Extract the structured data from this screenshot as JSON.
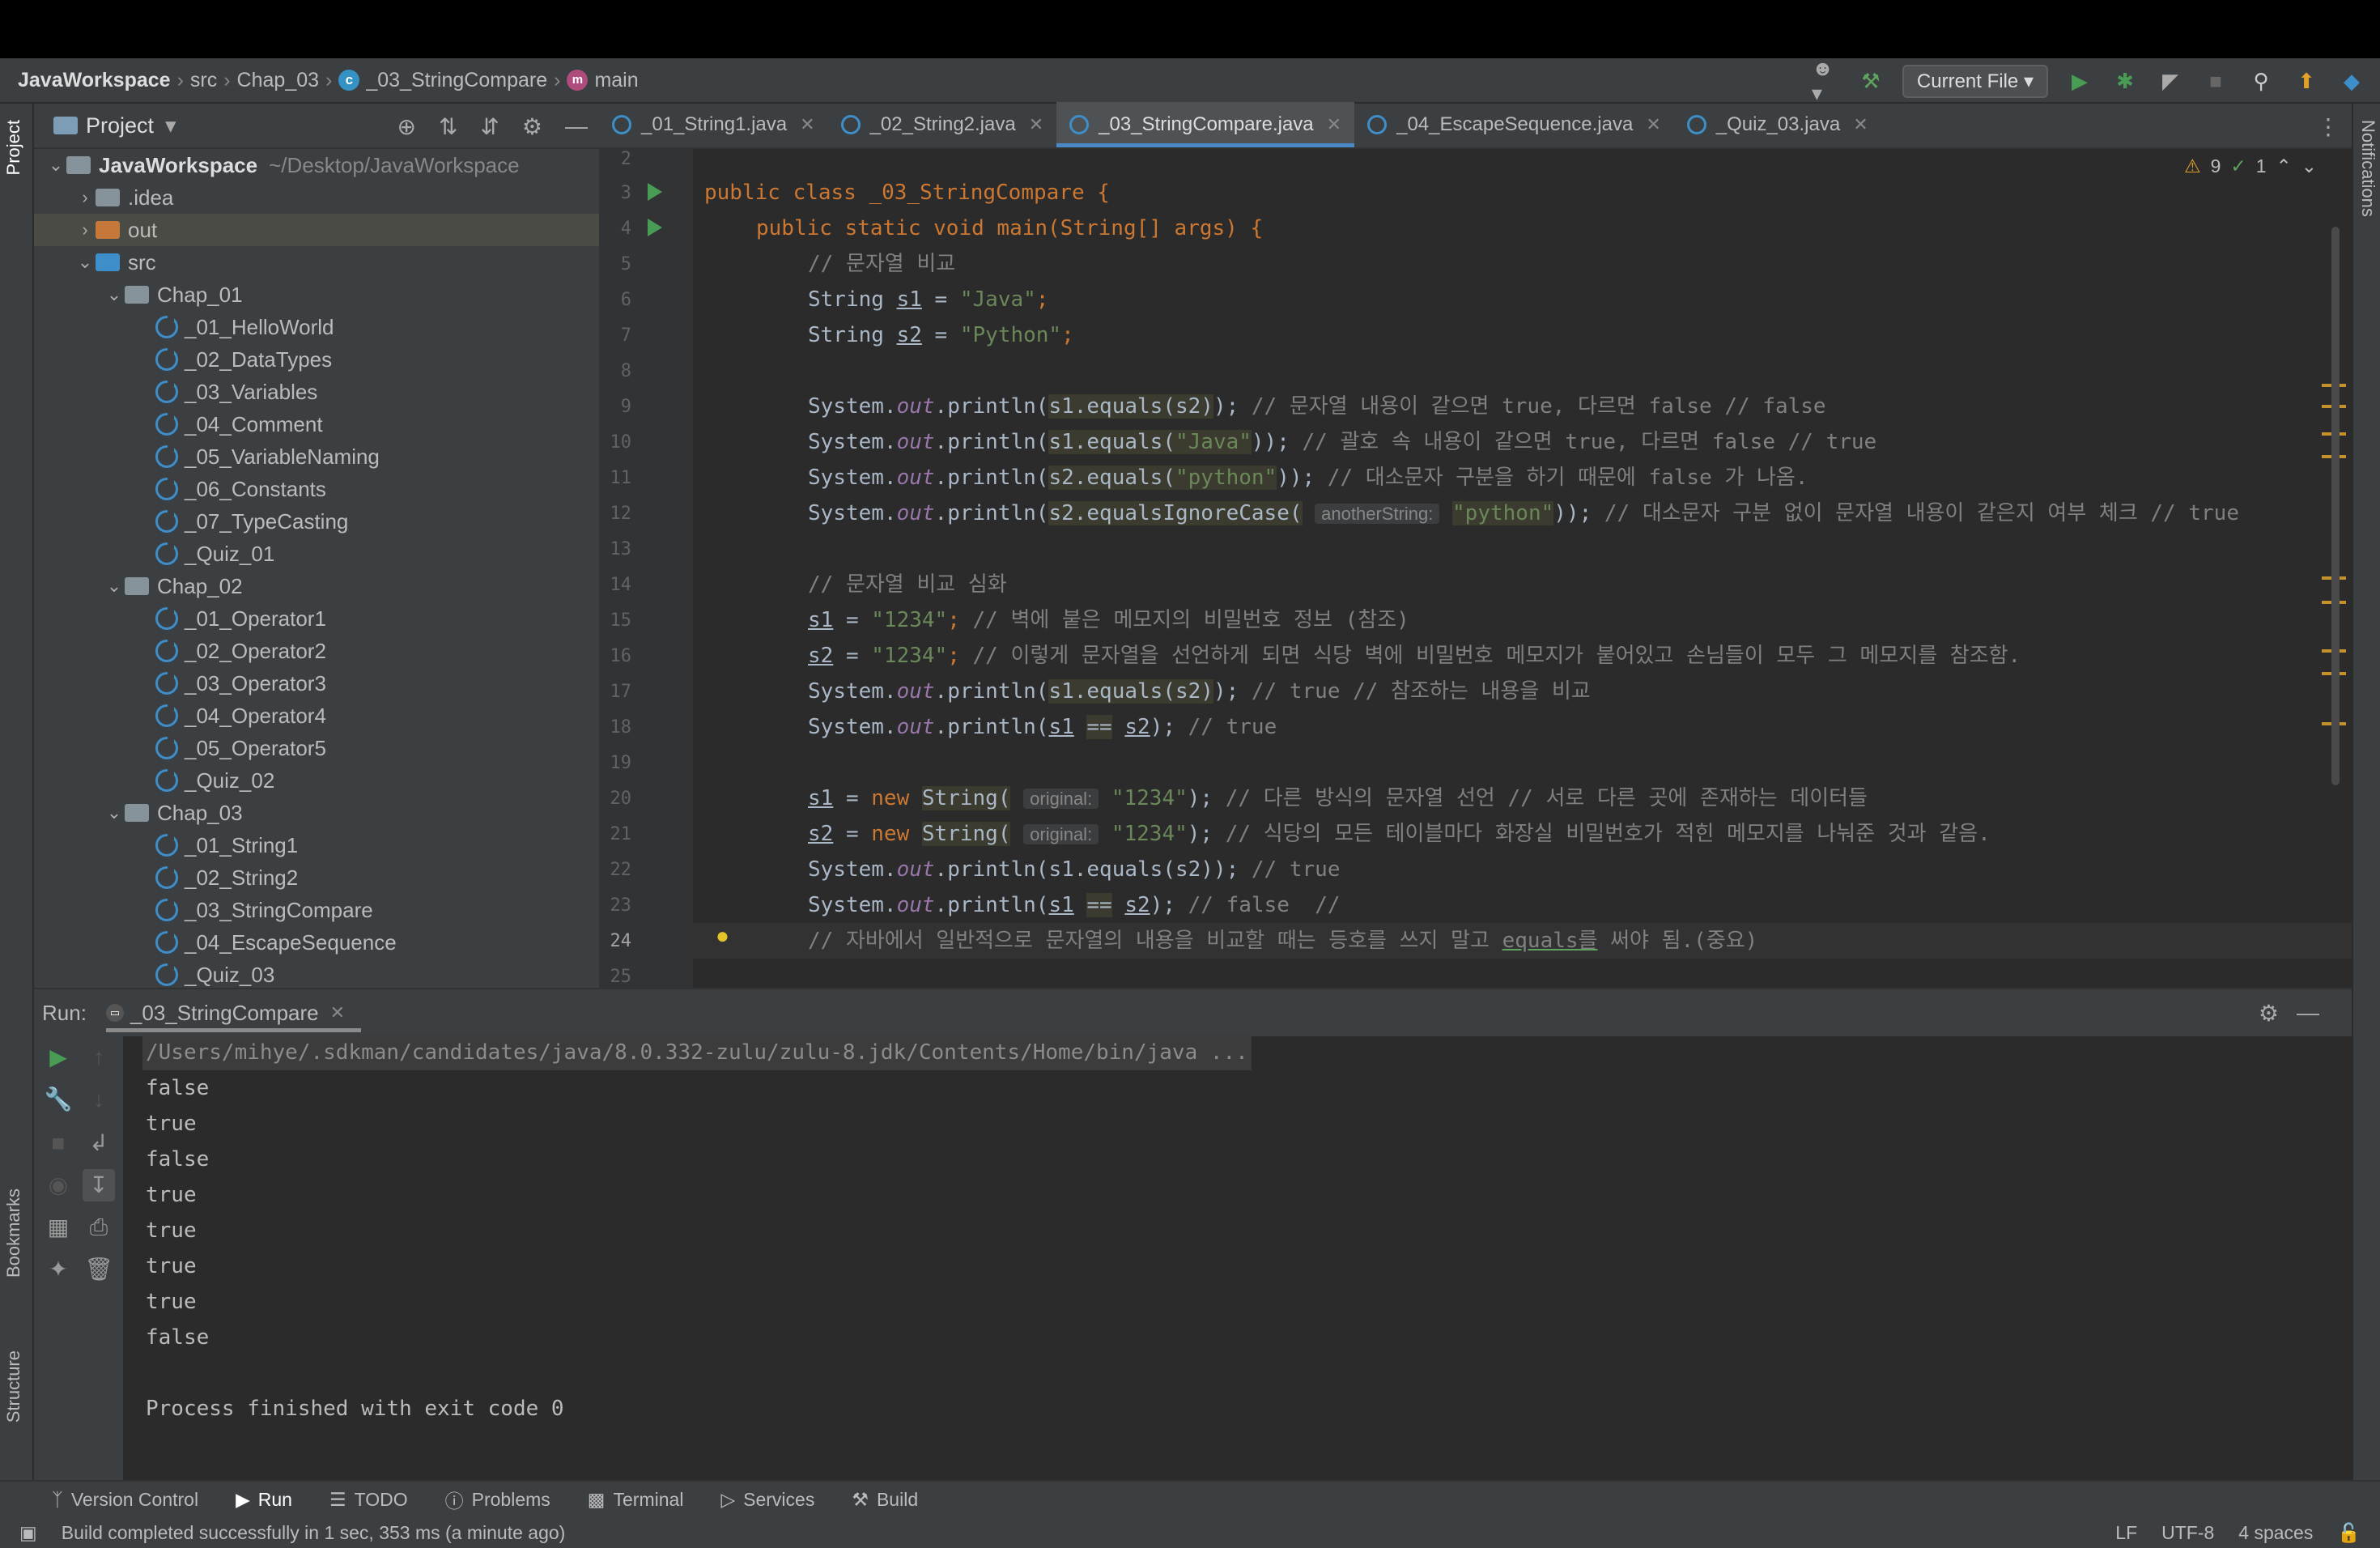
{
  "navbar": {
    "crumbs": [
      "JavaWorkspace",
      "src",
      "Chap_03",
      "_03_StringCompare",
      "main"
    ],
    "run_config": "Current File ▾"
  },
  "project": {
    "title": "Project",
    "root": {
      "name": "JavaWorkspace",
      "path": "~/Desktop/JavaWorkspace"
    },
    "items": [
      {
        "label": ".idea",
        "kind": "folder"
      },
      {
        "label": "out",
        "kind": "folder-orange"
      },
      {
        "label": "src",
        "kind": "folder-blue"
      },
      {
        "label": "Chap_01",
        "kind": "package"
      },
      {
        "label": "_01_HelloWorld",
        "kind": "class"
      },
      {
        "label": "_02_DataTypes",
        "kind": "class"
      },
      {
        "label": "_03_Variables",
        "kind": "class"
      },
      {
        "label": "_04_Comment",
        "kind": "class"
      },
      {
        "label": "_05_VariableNaming",
        "kind": "class"
      },
      {
        "label": "_06_Constants",
        "kind": "class"
      },
      {
        "label": "_07_TypeCasting",
        "kind": "class"
      },
      {
        "label": "_Quiz_01",
        "kind": "class"
      },
      {
        "label": "Chap_02",
        "kind": "package"
      },
      {
        "label": "_01_Operator1",
        "kind": "class"
      },
      {
        "label": "_02_Operator2",
        "kind": "class"
      },
      {
        "label": "_03_Operator3",
        "kind": "class"
      },
      {
        "label": "_04_Operator4",
        "kind": "class"
      },
      {
        "label": "_05_Operator5",
        "kind": "class"
      },
      {
        "label": "_Quiz_02",
        "kind": "class"
      },
      {
        "label": "Chap_03",
        "kind": "package"
      },
      {
        "label": "_01_String1",
        "kind": "class"
      },
      {
        "label": "_02_String2",
        "kind": "class"
      },
      {
        "label": "_03_StringCompare",
        "kind": "class"
      },
      {
        "label": "_04_EscapeSequence",
        "kind": "class"
      },
      {
        "label": "_Quiz_03",
        "kind": "class"
      }
    ]
  },
  "tabs": [
    "_01_String1.java",
    "_02_String2.java",
    "_03_StringCompare.java",
    "_04_EscapeSequence.java",
    "_Quiz_03.java"
  ],
  "editor": {
    "warnings": "9",
    "checks": "1",
    "line_numbers": [
      "2",
      "3",
      "4",
      "5",
      "6",
      "7",
      "8",
      "9",
      "10",
      "11",
      "12",
      "13",
      "14",
      "15",
      "16",
      "17",
      "18",
      "19",
      "20",
      "21",
      "22",
      "23",
      "24",
      "25"
    ],
    "code": {
      "l3": "public class _03_StringCompare {",
      "l4": "public static void main(String[] args) {",
      "l5": "// 문자열 비교",
      "l6a": "String ",
      "l6b": "s1",
      "l6c": " = ",
      "l6d": "\"Java\"",
      "l6e": ";",
      "l7a": "String ",
      "l7b": "s2",
      "l7c": " = ",
      "l7d": "\"Python\"",
      "l7e": ";",
      "sys": "System.",
      "out": "out",
      "println": ".println(",
      "l9_expr": "s1.equals(s2)",
      "l9_cm": "// 문자열 내용이 같으면 true, 다르면 false // false",
      "l10_expr": "s1.equals(",
      "l10_str": "\"Java\"",
      "l10_cm": "// 괄호 속 내용이 같으면 true, 다르면 false // true",
      "l11_expr": "s2.equals(",
      "l11_str": "\"python\"",
      "l11_cm": "// 대소문자 구분을 하기 때문에 false 가 나옴.",
      "l12_expr": "s2.equalsIgnoreCase(",
      "l12_hint": "anotherString:",
      "l12_str": "\"python\"",
      "l12_cm": "// 대소문자 구분 없이 문자열 내용이 같은지 여부 체크 // true",
      "l14": "// 문자열 비교 심화",
      "l15_str": "\"1234\"",
      "l15_cm": "// 벽에 붙은 메모지의 비밀번호 정보 (참조)",
      "l16_cm": "// 이렇게 문자열을 선언하게 되면 식당 벽에 비밀번호 메모지가 붙어있고 손님들이 모두 그 메모지를 참조함.",
      "l17_cm": "// true // 참조하는 내용을 비교",
      "l18_cm": "// true",
      "new_kw": "new ",
      "string_cls": "String(",
      "orig_hint": "original:",
      "l20_cm": "// 다른 방식의 문자열 선언 // 서로 다른 곳에 존재하는 데이터들",
      "l21_cm": "// 식당의 모든 테이블마다 화장실 비밀번호가 적힌 메모지를 나눠준 것과 같음.",
      "l22_cm": "// true",
      "l23_cm": "// false  //",
      "l24_cm_a": "// 자바에서 일반적으로 문자열의 내용을 비교할 때는 등호를 쓰지 말고 ",
      "l24_cm_b": "equals를",
      "l24_cm_c": " 써야 됨.(중요)"
    }
  },
  "run": {
    "label": "Run:",
    "tab": "_03_StringCompare",
    "command": "/Users/mihye/.sdkman/candidates/java/8.0.332-zulu/zulu-8.jdk/Contents/Home/bin/java ...",
    "output": [
      "false",
      "true",
      "false",
      "true",
      "true",
      "true",
      "true",
      "false"
    ],
    "exit": "Process finished with exit code 0"
  },
  "side_tabs": {
    "project": "Project",
    "bookmarks": "Bookmarks",
    "structure": "Structure",
    "notifications": "Notifications"
  },
  "bottom_tabs": [
    "Version Control",
    "Run",
    "TODO",
    "Problems",
    "Terminal",
    "Services",
    "Build"
  ],
  "status": {
    "message": "Build completed successfully in 1 sec, 353 ms (a minute ago)",
    "line_sep": "LF",
    "encoding": "UTF-8",
    "indent": "4 spaces"
  },
  "colors": {
    "keyword": "#cc7832",
    "string": "#6a8759",
    "comment": "#808080",
    "function": "#ffc66d",
    "field": "#9876aa",
    "accent": "#4a88c7"
  }
}
